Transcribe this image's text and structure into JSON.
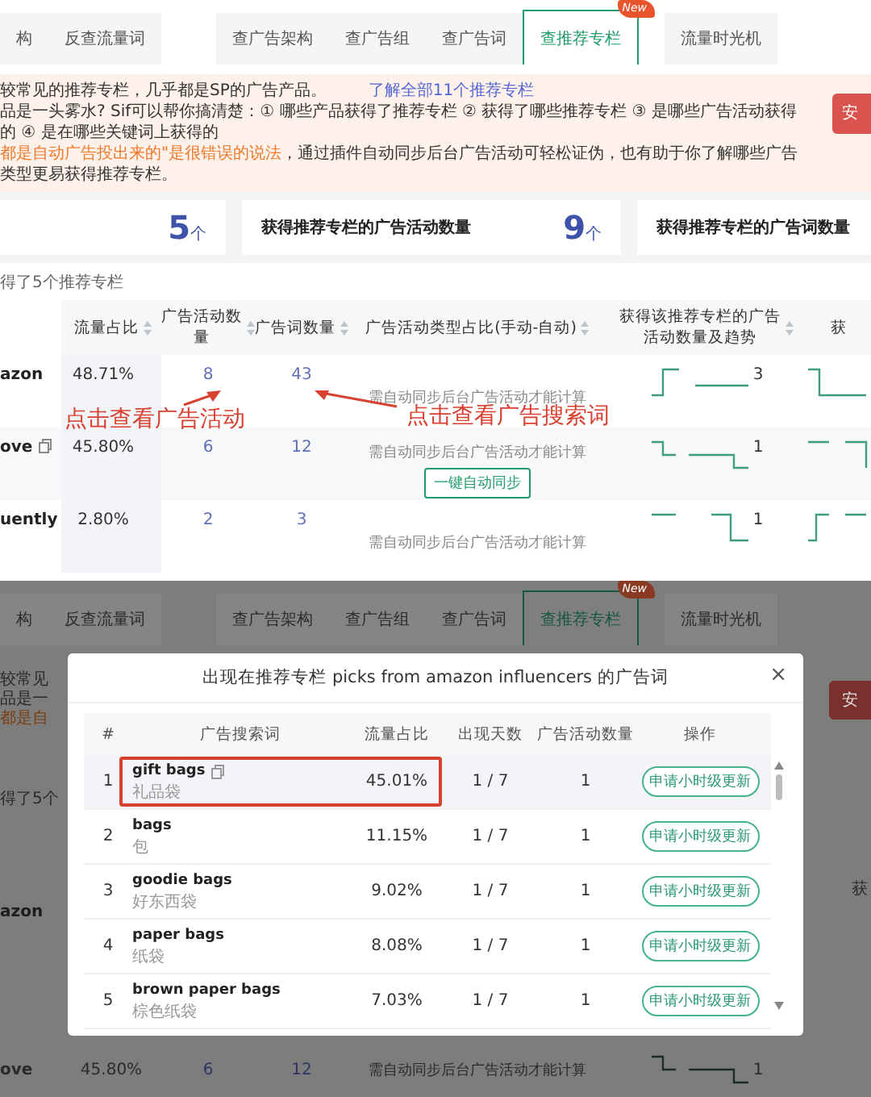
{
  "page": {
    "tabs": [
      {
        "label": "构",
        "selected": false
      },
      {
        "label": "反查流量词",
        "selected": false
      },
      {
        "label": "查广告架构",
        "selected": false
      },
      {
        "label": "查广告组",
        "selected": false
      },
      {
        "label": "查广告词",
        "selected": false
      },
      {
        "label": "查推荐专栏",
        "selected": true,
        "badge": "New"
      },
      {
        "label": "流量时光机",
        "selected": false
      }
    ],
    "notice": {
      "line1": "较常见的推荐专栏，几乎都是SP的广告产品。",
      "link": "了解全部11个推荐专栏",
      "line2": "品是一头雾水? Sif可以帮你搞清楚：① 哪些产品获得了推荐专栏 ② 获得了哪些推荐专栏 ③ 是哪些广告活动获得的 ④ 是在哪些关键词上获得的",
      "line3_warning": "都是自动广告投出来的\"是很错误的说法",
      "line3_rest": "，通过插件自动同步后台广告活动可轻松证伪，也有助于你了解哪些广告类型更易获得推荐专栏。",
      "button": "安"
    },
    "stats": [
      {
        "value": "5",
        "unit": "个"
      },
      {
        "title": "获得推荐专栏的广告活动数量",
        "value": "9",
        "unit": "个"
      },
      {
        "title": "获得推荐专栏的广告词数量"
      }
    ],
    "subtitle": "得了5个推荐专栏",
    "table": {
      "columns": [
        "流量占比",
        "广告活动数量",
        "广告词数量",
        "广告活动类型占比(手动-自动)",
        "获得该推荐专栏的广告活动数量及趋势",
        "获"
      ],
      "rows": [
        {
          "name": "azon",
          "copyable": false,
          "share": "48.71%",
          "campaigns": "8",
          "keywords": "43",
          "type_note": "需自动同步后台广告活动才能计算",
          "trend_count": "3"
        },
        {
          "name": "ove",
          "copyable": true,
          "share": "45.80%",
          "campaigns": "6",
          "keywords": "12",
          "type_note": "需自动同步后台广告活动才能计算",
          "sync_button": "一键自动同步",
          "trend_count": "1"
        },
        {
          "name": "uently",
          "copyable": false,
          "share": "2.80%",
          "campaigns": "2",
          "keywords": "3",
          "type_note": "需自动同步后台广告活动才能计算",
          "trend_count": "1"
        }
      ]
    },
    "annotations": [
      {
        "text": "点击查看广告活动"
      },
      {
        "text": "点击查看广告搜索词"
      }
    ]
  },
  "dialog_view": {
    "tabs": [
      {
        "label": "构",
        "selected": false
      },
      {
        "label": "反查流量词",
        "selected": false
      },
      {
        "label": "查广告架构",
        "selected": false
      },
      {
        "label": "查广告组",
        "selected": false
      },
      {
        "label": "查广告词",
        "selected": false
      },
      {
        "label": "查推荐专栏",
        "selected": true,
        "badge": "New"
      },
      {
        "label": "流量时光机",
        "selected": false
      }
    ],
    "left_fragments": [
      {
        "text": "较常见",
        "kind": "plain"
      },
      {
        "text": "品是一",
        "kind": "plain"
      },
      {
        "text": "都是自",
        "kind": "warning"
      },
      {
        "text": "得了5个",
        "kind": "plain"
      },
      {
        "text": "azon",
        "kind": "bold"
      }
    ],
    "right_fragments": [
      {
        "text": "安",
        "kind": "button"
      },
      {
        "text": "获",
        "kind": "plain"
      }
    ],
    "bottom_row": {
      "name": "ove",
      "share": "45.80%",
      "campaigns": "6",
      "keywords": "12",
      "type_note": "需自动同步后台广告活动才能计算",
      "trend_count": "1"
    },
    "dialog": {
      "title": "出现在推荐专栏 picks from amazon influencers 的广告词",
      "close": "×",
      "columns": [
        "#",
        "广告搜索词",
        "流量占比",
        "出现天数",
        "广告活动数量",
        "操作"
      ],
      "rows": [
        {
          "index": "1",
          "keyword": "gift bags",
          "translation": "礼品袋",
          "copyable": true,
          "selected": true,
          "boxed": true,
          "share": "45.01%",
          "days": "1 / 7",
          "campaigns": "1",
          "action": "申请小时级更新"
        },
        {
          "index": "2",
          "keyword": "bags",
          "translation": "包",
          "copyable": false,
          "selected": false,
          "boxed": false,
          "share": "11.15%",
          "days": "1 / 7",
          "campaigns": "1",
          "action": "申请小时级更新"
        },
        {
          "index": "3",
          "keyword": "goodie bags",
          "translation": "好东西袋",
          "copyable": false,
          "selected": false,
          "boxed": false,
          "share": "9.02%",
          "days": "1 / 7",
          "campaigns": "1",
          "action": "申请小时级更新"
        },
        {
          "index": "4",
          "keyword": "paper bags",
          "translation": "纸袋",
          "copyable": false,
          "selected": false,
          "boxed": false,
          "share": "8.08%",
          "days": "1 / 7",
          "campaigns": "1",
          "action": "申请小时级更新"
        },
        {
          "index": "5",
          "keyword": "brown paper bags",
          "translation": "棕色纸袋",
          "copyable": false,
          "selected": false,
          "boxed": false,
          "share": "7.03%",
          "days": "1 / 7",
          "campaigns": "1",
          "action": "申请小时级更新"
        }
      ]
    }
  }
}
